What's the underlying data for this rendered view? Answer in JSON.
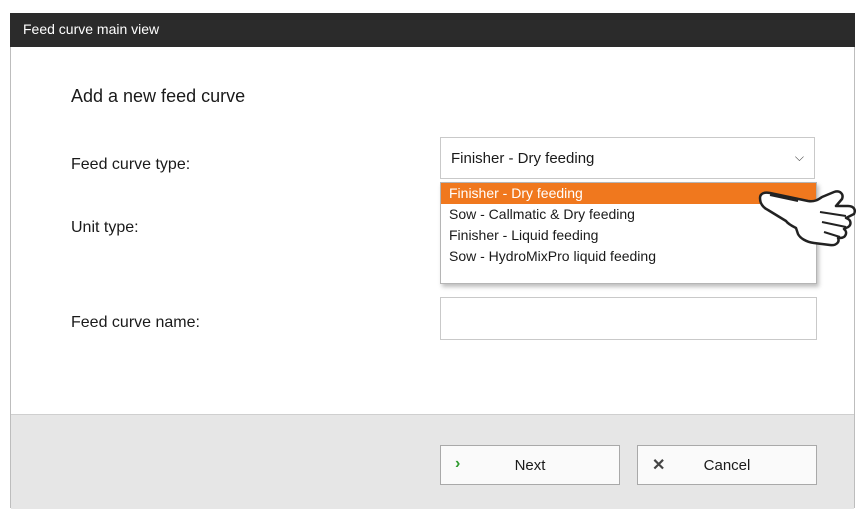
{
  "window": {
    "title": "Feed curve main view"
  },
  "form": {
    "heading": "Add a new feed curve",
    "feed_curve_type_label": "Feed curve type:",
    "unit_type_label": "Unit type:",
    "feed_curve_name_label": "Feed curve name:",
    "feed_curve_type_value": "Finisher - Dry feeding",
    "feed_curve_name_value": ""
  },
  "dropdown": {
    "options": [
      "Finisher - Dry feeding",
      "Sow - Callmatic & Dry feeding",
      "Finisher - Liquid feeding",
      "Sow - HydroMixPro liquid feeding"
    ],
    "selected_index": 0
  },
  "buttons": {
    "next_label": "Next",
    "cancel_label": "Cancel"
  },
  "icons": {
    "next": "chevron-right-icon",
    "cancel": "close-icon",
    "chevron": "chevron-down-icon",
    "pointer": "hand-pointer-icon"
  },
  "colors": {
    "selection": "#f0781e",
    "next_icon": "#2e9a2e",
    "titlebar": "#2b2b2b"
  }
}
